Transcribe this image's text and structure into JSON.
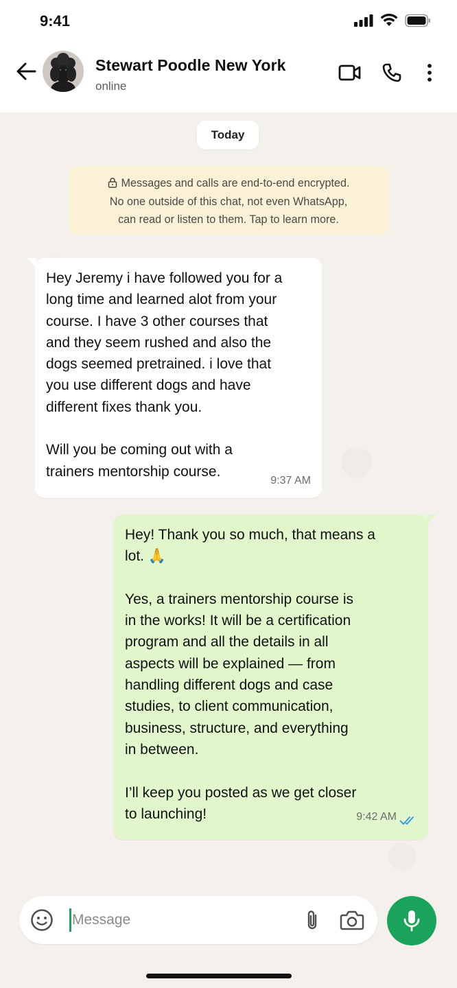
{
  "status_bar": {
    "time": "9:41"
  },
  "header": {
    "contact_name": "Stewart Poodle New York",
    "contact_status": "online",
    "icons": [
      "back-arrow-icon",
      "video-call-icon",
      "phone-icon",
      "more-options-icon"
    ]
  },
  "chat": {
    "date_chip": "Today",
    "encryption_notice": {
      "line1": "Messages and calls are end-to-end encrypted.",
      "line2": "No one outside of this chat, not even WhatsApp,",
      "line3": "can read or listen to them. Tap to learn more."
    },
    "messages": [
      {
        "direction": "incoming",
        "lines": [
          "Hey Jeremy i have followed you for a",
          "long time and learned alot from your",
          "course. I have 3 other courses that",
          "and they seem rushed and also the",
          "dogs seemed pretrained. i love that",
          "you use different dogs and have",
          "different fixes thank you.",
          "",
          "Will you be coming out with a",
          "trainers mentorship course."
        ],
        "time": "9:37 AM"
      },
      {
        "direction": "outgoing",
        "lines": [
          "Hey! Thank you so much, that means a",
          "lot. 🙏",
          "",
          "Yes, a trainers mentorship course is",
          "in the works! It will be a certification",
          "program and all the details in all",
          "aspects will be explained — from",
          "handling different dogs and case",
          "studies, to client communication,",
          "business, structure, and everything",
          "in between.",
          "",
          "I’ll keep you posted as we get closer",
          "to launching!"
        ],
        "time": "9:42 AM",
        "status": "read"
      }
    ]
  },
  "input": {
    "placeholder": "Message",
    "value": ""
  },
  "colors": {
    "accent": "#1aa35b",
    "outgoing_bubble": "#e1f7cb",
    "incoming_bubble": "#ffffff",
    "encryption_bg": "#fbf1d7",
    "chat_bg": "#f4f1ec",
    "read_receipt": "#3b9be8"
  }
}
